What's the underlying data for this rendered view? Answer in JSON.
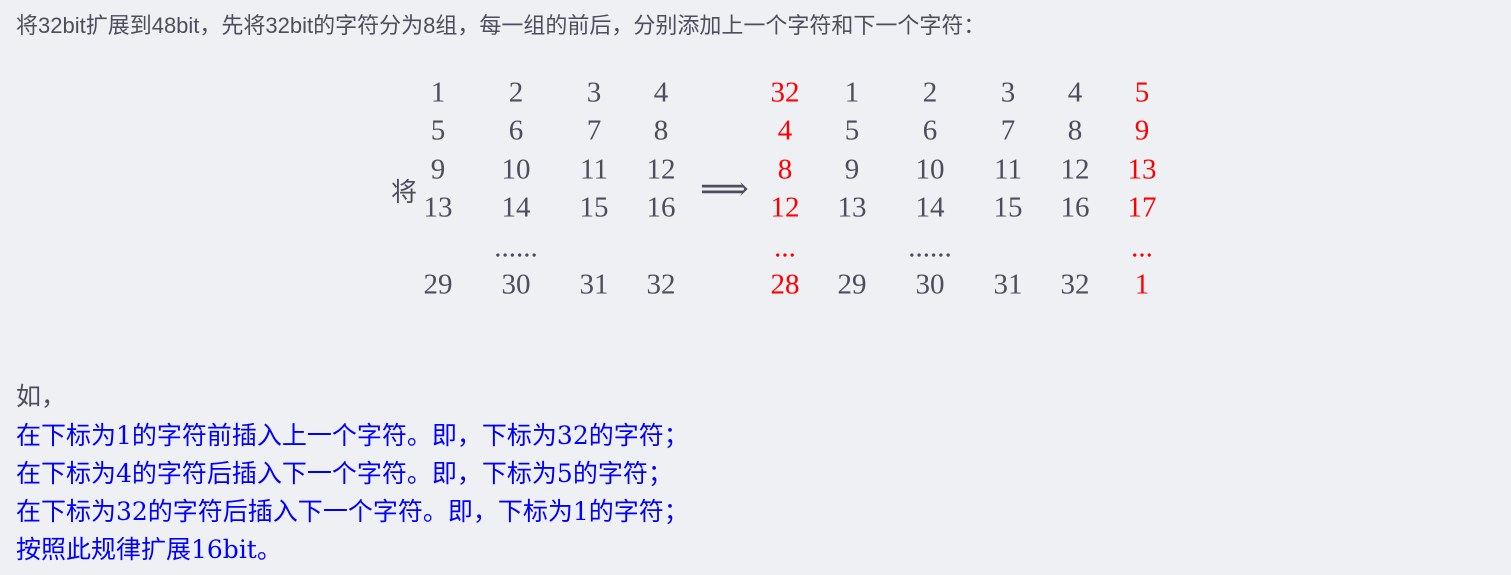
{
  "intro": "将32bit扩展到48bit，先将32bit的字符分为8组，每一组的前后，分别添加上一个字符和下一个字符：",
  "matrix": {
    "prefix": "将",
    "arrow": "⟹",
    "left_rows": [
      [
        "1",
        "2",
        "3",
        "4"
      ],
      [
        "5",
        "6",
        "7",
        "8"
      ],
      [
        "9",
        "10",
        "11",
        "12"
      ],
      [
        "13",
        "14",
        "15",
        "16"
      ],
      [
        "",
        "......",
        "",
        ""
      ],
      [
        "29",
        "30",
        "31",
        "32"
      ]
    ],
    "right_rows": [
      [
        "32",
        "1",
        "2",
        "3",
        "4",
        "5"
      ],
      [
        "4",
        "5",
        "6",
        "7",
        "8",
        "9"
      ],
      [
        "8",
        "9",
        "10",
        "11",
        "12",
        "13"
      ],
      [
        "12",
        "13",
        "14",
        "15",
        "16",
        "17"
      ],
      [
        "...",
        "",
        "......",
        "",
        "",
        "..."
      ],
      [
        "28",
        "29",
        "30",
        "31",
        "32",
        "1"
      ]
    ],
    "highlight_color": "#ff0000"
  },
  "example": {
    "heading": "如，",
    "lines": [
      "在下标为1的字符前插入上一个字符。即，下标为32的字符；",
      "在下标为4的字符后插入下一个字符。即，下标为5的字符；",
      "在下标为32的字符后插入下一个字符。即，下标为1的字符；",
      "按照此规律扩展16bit。"
    ],
    "color": "#0000ff"
  }
}
